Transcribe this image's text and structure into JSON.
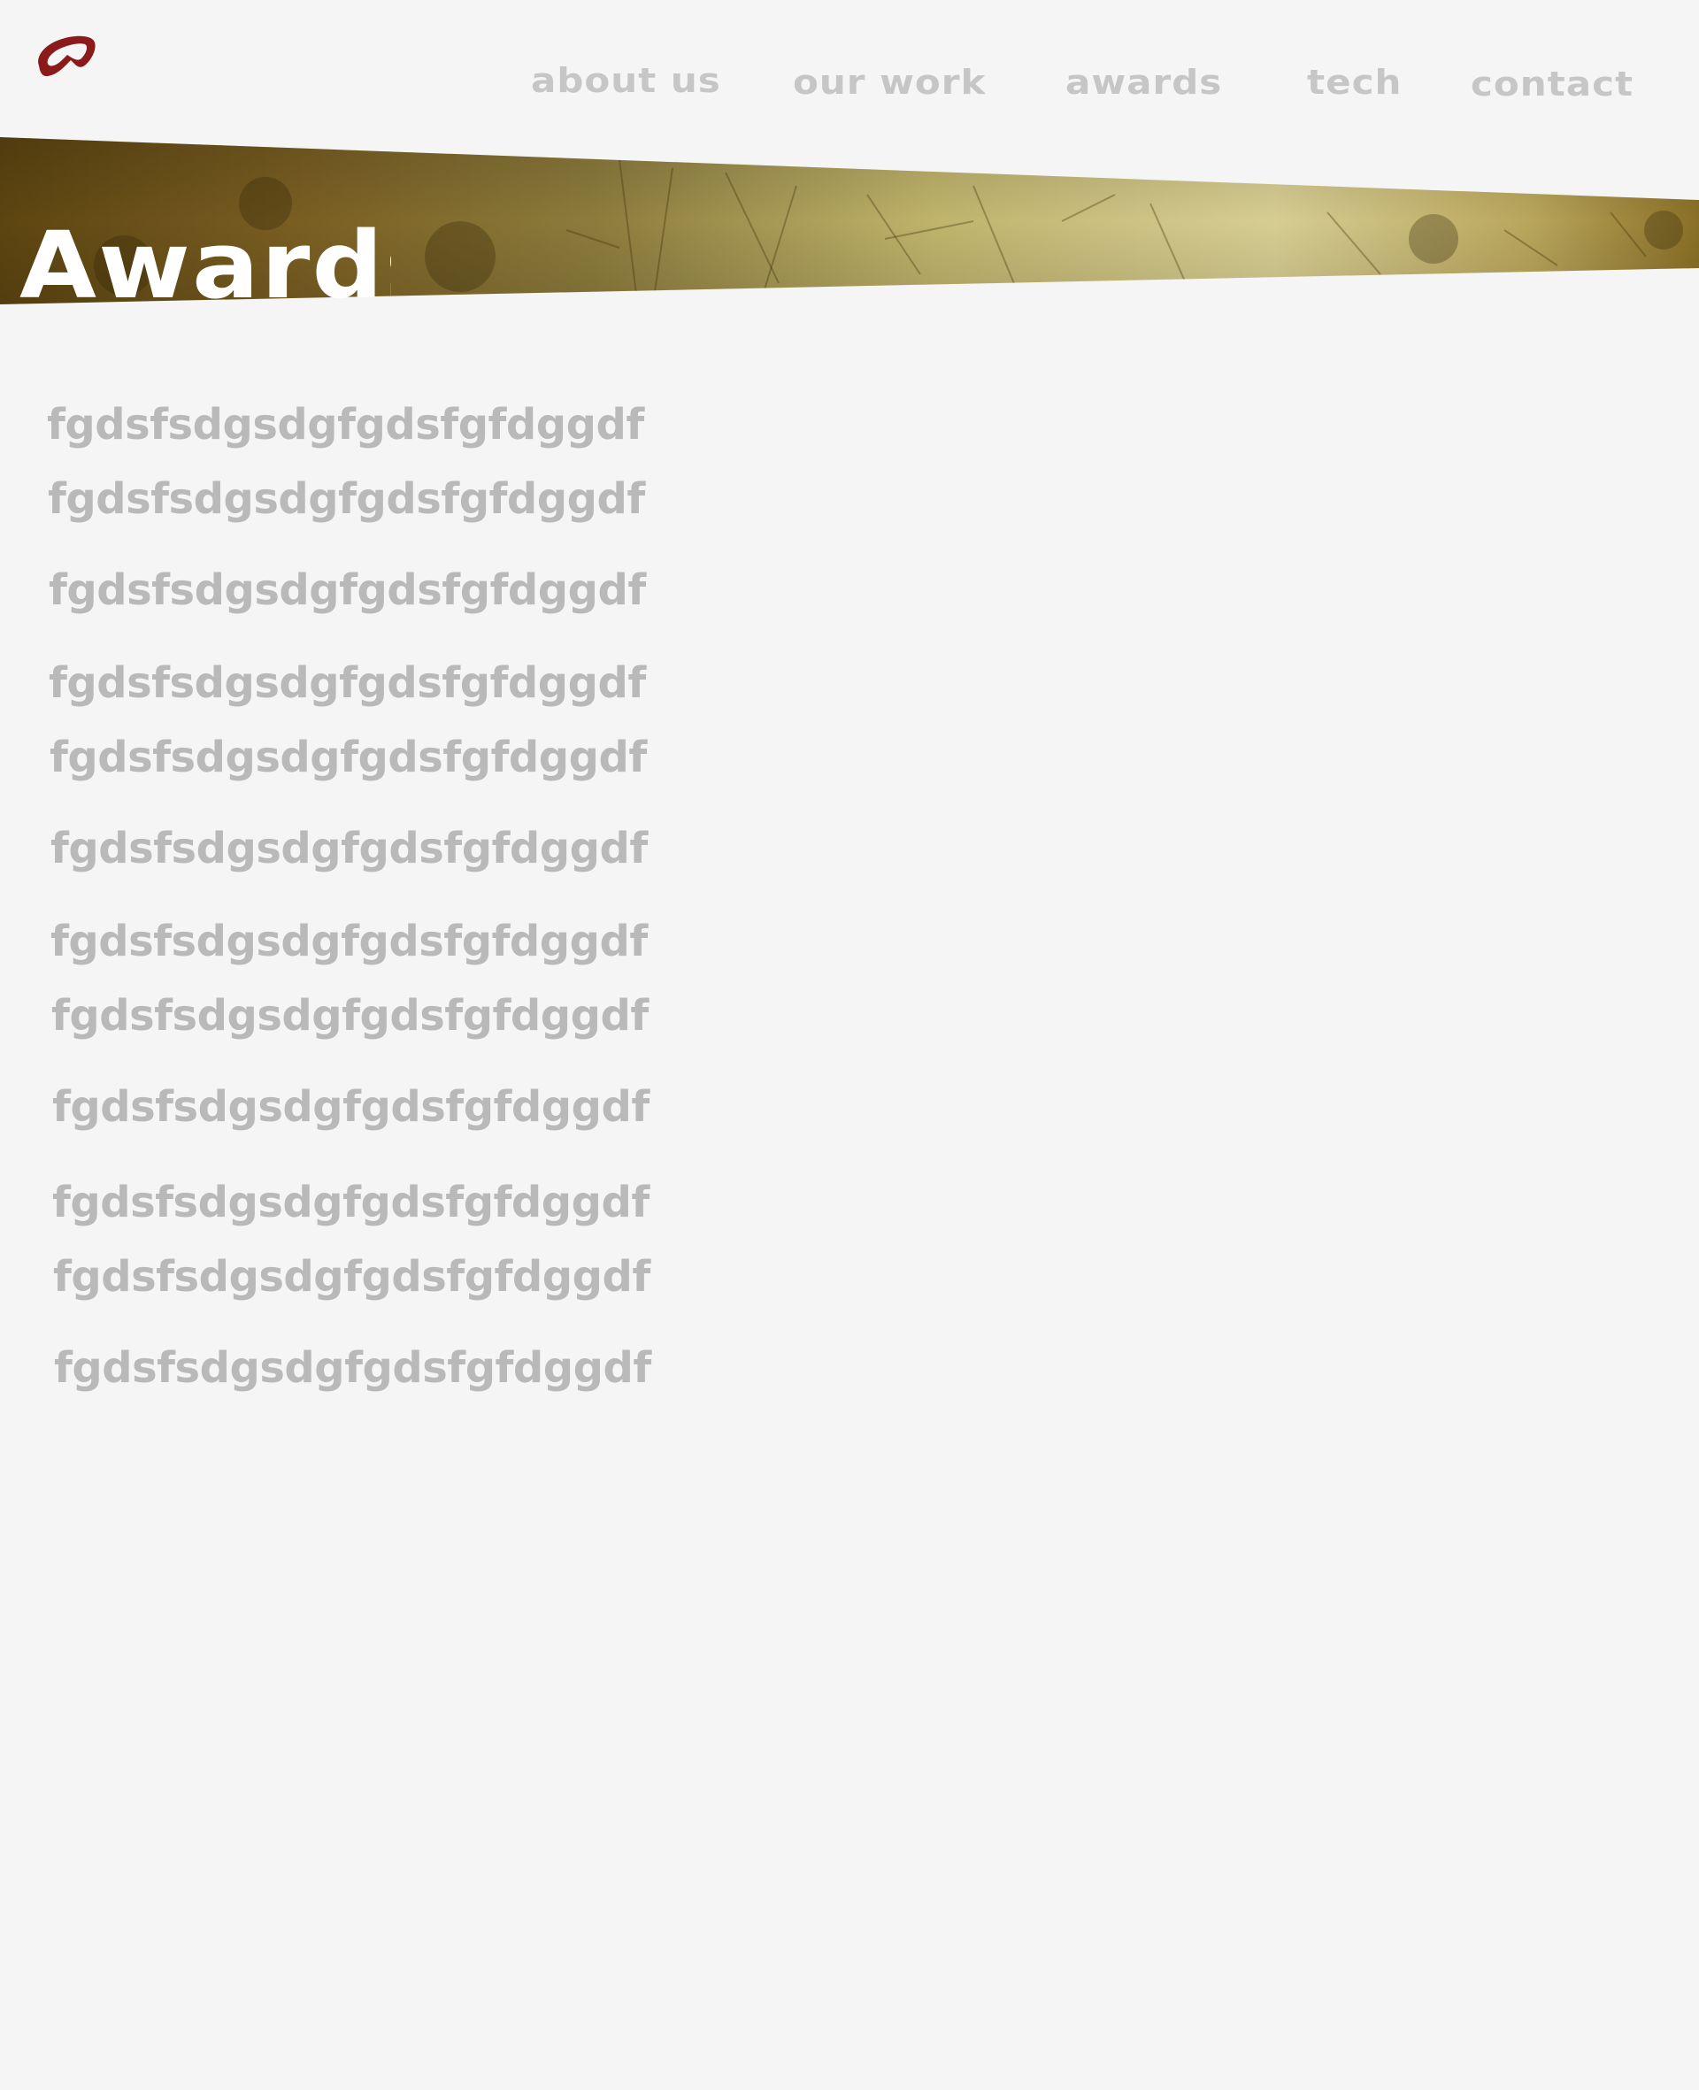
{
  "header": {
    "logo_icon": "red-loop-logo-icon",
    "brand_color": "#8b1a1a",
    "nav": [
      {
        "label": "about us"
      },
      {
        "label": "our work"
      },
      {
        "label": "awards"
      },
      {
        "label": "tech"
      },
      {
        "label": "contact"
      }
    ]
  },
  "banner": {
    "title": "Awards",
    "texture_colors": [
      "#5f4712",
      "#8e7a3a",
      "#c9bd7a",
      "#d8d096"
    ]
  },
  "awards": {
    "items": [
      "fgdsfsdgsdgfgdsfgfdggdf",
      "fgdsfsdgsdgfgdsfgfdggdf",
      "fgdsfsdgsdgfgdsfgfdggdf",
      "fgdsfsdgsdgfgdsfgfdggdf",
      "fgdsfsdgsdgfgdsfgfdggdf",
      "fgdsfsdgsdgfgdsfgfdggdf",
      "fgdsfsdgsdgfgdsfgfdggdf",
      "fgdsfsdgsdgfgdsfgfdggdf",
      "fgdsfsdgsdgfgdsfgfdggdf",
      "fgdsfsdgsdgfgdsfgfdggdf",
      "fgdsfsdgsdgfgdsfgfdggdf",
      "fgdsfsdgsdgfgdsfgfdggdf"
    ]
  }
}
